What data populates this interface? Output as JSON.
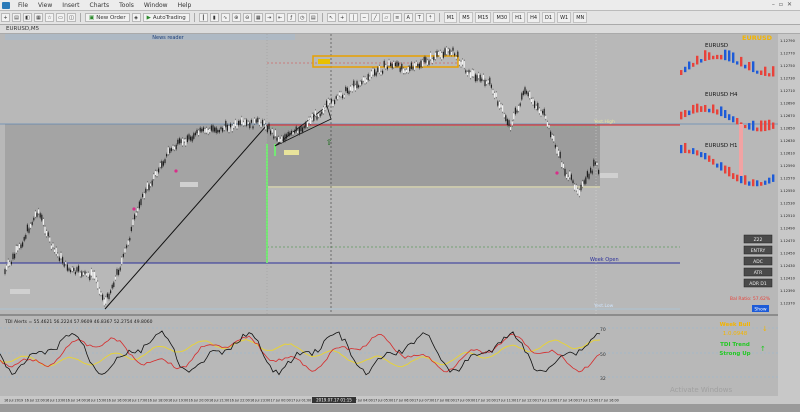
{
  "menu": [
    "File",
    "View",
    "Insert",
    "Charts",
    "Tools",
    "Window",
    "Help"
  ],
  "toolbar": {
    "new_order": "New Order",
    "autotrading": "AutoTrading",
    "timeframes": [
      "M1",
      "M5",
      "M15",
      "M30",
      "H1",
      "H4",
      "D1",
      "W1",
      "MN"
    ]
  },
  "chart_tab": "EURUSD,M5",
  "news_reader": "News reader",
  "levels": {
    "week_open": "Week Open",
    "yest_high": "Yest.High",
    "yest_low": "Yest.Low"
  },
  "mini_charts": [
    {
      "title": "EURUSD",
      "accent": "#f3b400"
    },
    {
      "title": "EURUSD H4"
    },
    {
      "title": "EURUSD H1"
    }
  ],
  "side_buttons": [
    "Z22",
    "ENTRY",
    "ADC",
    "ATR",
    "ADR D1"
  ],
  "bar_ratio": "Bal Ratio: 57.62%",
  "show_button": "Show",
  "indicator_label": "TDI Alerts = 55.4621 56.2224 57.9609 46.8367 52.2754 49.8060",
  "indicator_levels": [
    "70",
    "50",
    "32"
  ],
  "tdi_panel": {
    "week_bull": "Week Bull",
    "week_bull_value": "1.0.0948",
    "trend": "TDI Trend",
    "trend_state": "Strong Up"
  },
  "time_axis": [
    "16 Jul 2019",
    "16 Jul 12:00",
    "16 Jul 13:00",
    "16 Jul 14:00",
    "16 Jul 15:00",
    "16 Jul 16:00",
    "16 Jul 17:00",
    "16 Jul 18:00",
    "16 Jul 19:00",
    "16 Jul 20:00",
    "16 Jul 21:00",
    "16 Jul 22:00",
    "16 Jul 23:00",
    "17 Jul 00:00",
    "17 Jul 01:00",
    "17 Jul 02:00",
    "17 Jul 03:00",
    "17 Jul 04:00",
    "17 Jul 05:00",
    "17 Jul 06:00",
    "17 Jul 07:00",
    "17 Jul 08:00",
    "17 Jul 09:00",
    "17 Jul 10:00",
    "17 Jul 11:00",
    "17 Jul 12:00",
    "17 Jul 13:00",
    "17 Jul 14:00",
    "17 Jul 15:00",
    "17 Jul 16:00"
  ],
  "crosshair_time": "2019.07.17 01:15",
  "price_axis": [
    "1.12790",
    "1.12770",
    "1.12750",
    "1.12730",
    "1.12710",
    "1.12690",
    "1.12670",
    "1.12650",
    "1.12630",
    "1.12610",
    "1.12590",
    "1.12570",
    "1.12550",
    "1.12530",
    "1.12510",
    "1.12490",
    "1.12470",
    "1.12450",
    "1.12430",
    "1.12410",
    "1.12390",
    "1.12370"
  ],
  "activate": "Activate Windows",
  "colors": {
    "accent": "#f3b400",
    "bull": "#1d5bd8",
    "bear": "#e8423a",
    "green": "#22c822"
  }
}
